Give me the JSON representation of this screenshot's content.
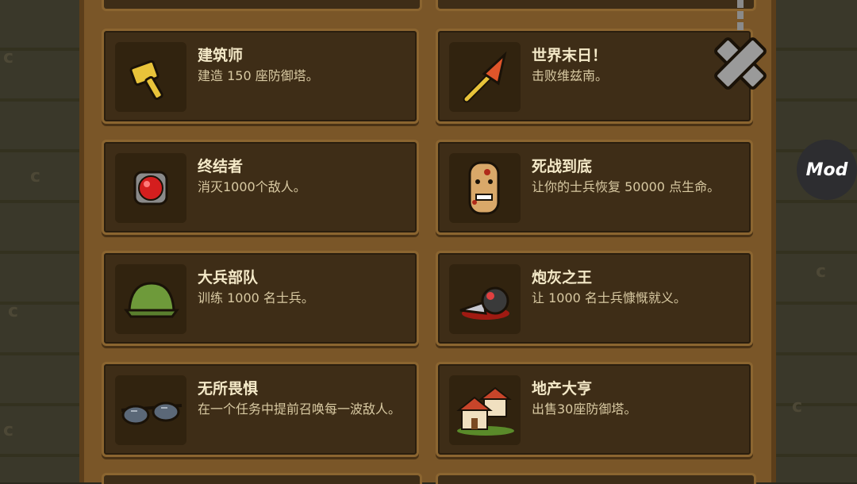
{
  "mod_button": {
    "label": "Mod"
  },
  "achievements": [
    {
      "title": "建筑师",
      "desc": "建造 150 座防御塔。",
      "icon": "hammer-icon"
    },
    {
      "title": "世界末日！",
      "desc": "击败维兹南。",
      "icon": "spear-icon"
    },
    {
      "title": "终结者",
      "desc": "消灭1000个敌人。",
      "icon": "red-gem-icon"
    },
    {
      "title": "死战到底",
      "desc": "让你的士兵恢复 50000 点生命。",
      "icon": "bloody-face-icon"
    },
    {
      "title": "大兵部队",
      "desc": "训练 1000 名士兵。",
      "icon": "helmet-icon"
    },
    {
      "title": "炮灰之王",
      "desc": "让 1000 名士兵慷慨就义。",
      "icon": "fallen-soldier-icon"
    },
    {
      "title": "无所畏惧",
      "desc": "在一个任务中提前召唤每一波敌人。",
      "icon": "sunglasses-icon"
    },
    {
      "title": "地产大亨",
      "desc": "出售30座防御塔。",
      "icon": "houses-icon"
    }
  ],
  "colors": {
    "board": "#7a5628",
    "card": "#3e2d17",
    "title": "#f4e9c8",
    "desc": "#d8c9a2"
  }
}
